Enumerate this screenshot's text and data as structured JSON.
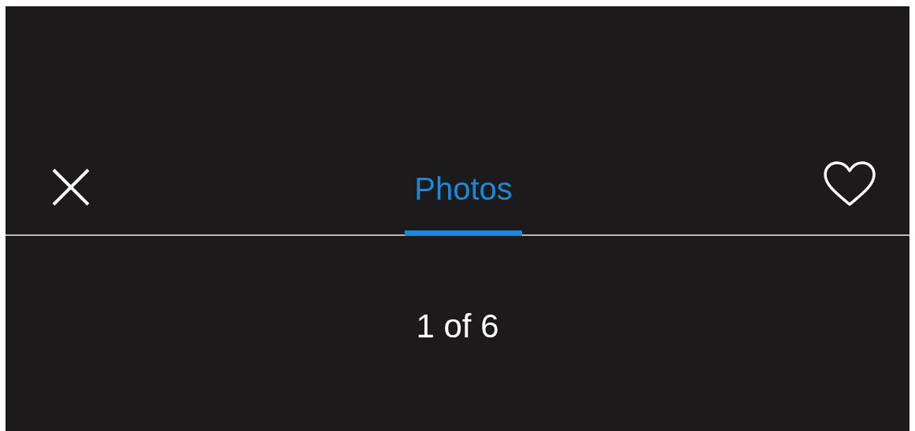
{
  "header": {
    "tabs": [
      {
        "label": "Photos",
        "selected": true
      }
    ]
  },
  "counter": "1 of 6"
}
